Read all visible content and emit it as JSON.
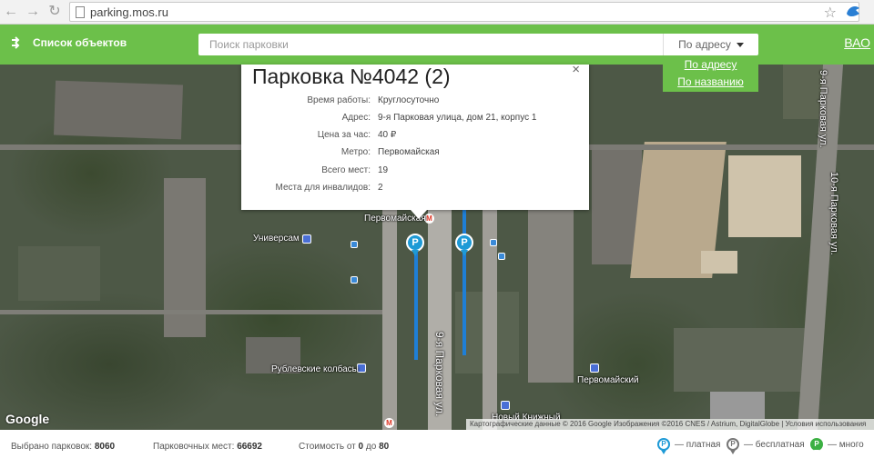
{
  "browser": {
    "url": "parking.mos.ru"
  },
  "header": {
    "objects_label": "Список объектов",
    "search_placeholder": "Поиск парковки",
    "search_mode": "По адресу",
    "district": "ВАО",
    "mode_options": [
      "По адресу",
      "По названию"
    ]
  },
  "popup": {
    "title": "Парковка №4042 (2)",
    "close": "×",
    "rows": [
      {
        "label": "Время работы:",
        "value": "Круглосуточно"
      },
      {
        "label": "Адрес:",
        "value": "9-я Парковая улица, дом 21, корпус 1"
      },
      {
        "label": "Цена за час:",
        "value": "40 ₽"
      },
      {
        "label": "Метро:",
        "value": "Первомайская"
      },
      {
        "label": "Всего мест:",
        "value": "19"
      },
      {
        "label": "Места для инвалидов:",
        "value": "2"
      }
    ]
  },
  "map": {
    "labels": {
      "universam": "Универсам",
      "pervomayskaya_metro": "Первомайская",
      "rublevskie": "Рублевские колбасы",
      "pervomayskiy": "Первомайский",
      "noviy_knizhniy": "Новый Книжный",
      "street_9": "9-я Парковая ул.",
      "street_9_top": "9-я Парковая ул.",
      "street_10": "10-я Парковая ул."
    },
    "pin_symbol": "P",
    "metro_symbol": "M",
    "google": "Google",
    "attribution": "Картографические данные © 2016 Google Изображения ©2016 CNES / Astrium, DigitalGlobe | Условия использования"
  },
  "footer": {
    "selected_label": "Выбрано парковок:",
    "selected_value": "8060",
    "places_label": "Парковочных мест:",
    "places_value": "66692",
    "cost_label": "Стоимость от",
    "cost_from": "0",
    "cost_to_label": "до",
    "cost_to": "80",
    "legend": [
      {
        "label": "— платная",
        "color": "#1e9ad6"
      },
      {
        "label": "— бесплатная",
        "color": "#777777"
      },
      {
        "label": "— много",
        "color": "#3cb043"
      }
    ]
  },
  "colors": {
    "header_green": "#6cc04a",
    "pin_blue": "#1e9ad6"
  }
}
